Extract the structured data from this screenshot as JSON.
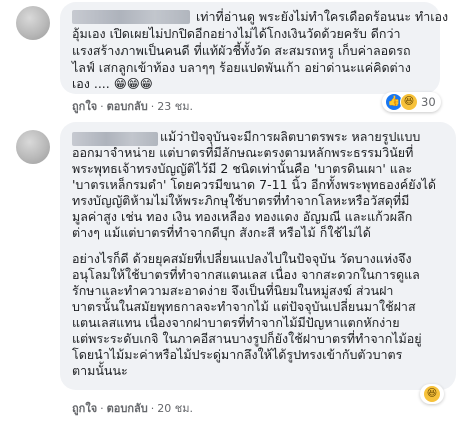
{
  "comments": [
    {
      "lines": [
        "เท่าที่อ่านดู พระยังไม่ทำใครเดือดร้อนนะ ทำเอง",
        "อุ้มเอง เปิดเผยไม่ปกปิดอีกอย่างไม่ได้โกงเงินวัดด้วยครับ ดีกว่า",
        "แรงสร้างภาพเป็นคนดี ที่แท้ผัวชี้ทั้งวัด สะสมรถหรู เก็บค่าลอดรถ",
        "ไลฟ์ เสกลูกเข้าท้อง บลาๆๆ ร้อยแปดพันเก้า อย่าด่านะแค่คิดต่าง",
        "เอง .... 😁😁😁"
      ],
      "actions": {
        "like": "ถูกใจ",
        "reply": "ตอบกลับ",
        "time": "23 ชม."
      },
      "reactions": {
        "icons": [
          "like-icon",
          "haha-icon"
        ],
        "count": "30"
      }
    },
    {
      "lines": [
        "แม้ว่าปัจจุบันจะมีการผลิตบาตรพระ หลายรูปแบบ",
        "ออกมาจำหน่าย แต่บาตรที่มีลักษณะตรงตามหลักพระธรรมวินัยที่",
        "พระพุทธเจ้าทรงบัญญัติไว้มี 2 ชนิดเท่านั้นคือ 'บาตรดินเผา' และ",
        "'บาตรเหล็กรมดำ' โดยควรมีขนาด 7-11 นิ้ว อีกทั้งพระพุทธองค์ยังได้",
        "ทรงบัญญัติห้ามไม่ให้พระภิกษุใช้บาตรที่ทำจากโลหะหรือวัสดุที่มี",
        "มูลค่าสูง เช่น ทอง เงิน ทองเหลือง ทองแดง อัญมณี และแก้วผลึก",
        "ต่างๆ แม้แต่บาตรที่ทำจากดีบุก สังกะสี หรือไม้ ก็ใช้ไม่ได้",
        "",
        "อย่างไรก็ดี ด้วยยุคสมัยที่เปลี่ยนแปลงไปในปัจจุบัน วัดบางแห่งจึง",
        "อนุโลมให้ใช้บาตรที่ทำจากสแตนเลส เนื่อง จากสะดวกในการดูแล",
        "รักษาและทำความสะอาดง่าย จึงเป็นที่นิยมในหมู่สงฆ์ ส่วนฝา",
        "บาตรนั้นในสมัยพุทธกาลจะทำจากไม้ แต่ปัจจุบันเปลี่ยนมาใช้ฝาส",
        "แตนเลสแทน เนื่องจากฝาบาตรที่ทำจากไม้มีปัญหาแตกหักง่าย",
        "แต่พระระดับเกจิ ในภาคอีสานบางรูปก็ยังใช้ฝาบาตรที่ทำจากไม้อยู่",
        "โดยนำไม้มะค่าหรือไม้ประดู่มากลึงให้ได้รูปทรงเข้ากับตัวบาตร",
        "ตามนั้นนะ"
      ],
      "actions": {
        "like": "ถูกใจ",
        "reply": "ตอบกลับ",
        "time": "20 ชม."
      },
      "reactions": {
        "icons": [
          "haha-icon"
        ],
        "count": ""
      }
    }
  ],
  "icons": {
    "menu": "more-options-icon"
  },
  "colors": {
    "bubble": "#f0f2f5",
    "meta": "#65676b",
    "like": "#1877f2",
    "haha": "#f7c23b"
  }
}
